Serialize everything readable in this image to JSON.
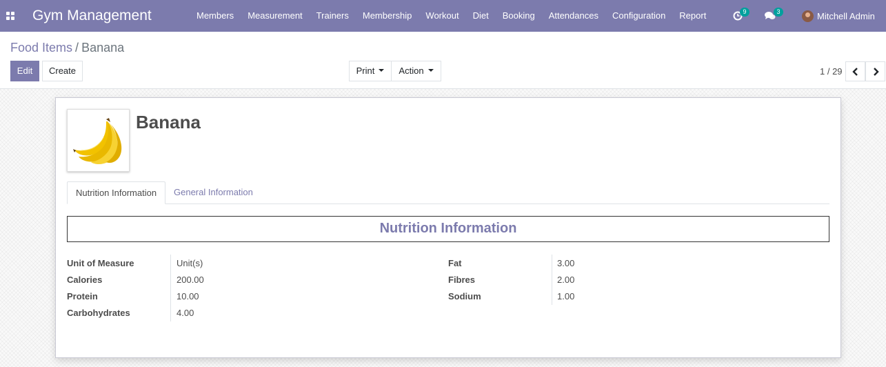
{
  "navbar": {
    "brand": "Gym Management",
    "menu": [
      "Members",
      "Measurement",
      "Trainers",
      "Membership",
      "Workout",
      "Diet",
      "Booking",
      "Attendances",
      "Configuration",
      "Report"
    ],
    "activity_count": "9",
    "message_count": "3",
    "user_name": "Mitchell Admin",
    "color": "#7c7bad"
  },
  "breadcrumb": {
    "parent": "Food Items",
    "separator": "/",
    "current": "Banana"
  },
  "toolbar": {
    "edit_label": "Edit",
    "create_label": "Create",
    "print_label": "Print",
    "action_label": "Action"
  },
  "pager": {
    "value": "1 / 29"
  },
  "record": {
    "title": "Banana",
    "image": "banana-image",
    "tabs": [
      "Nutrition Information",
      "General Information"
    ],
    "section_title": "Nutrition Information",
    "left_fields": [
      {
        "label": "Unit of Measure",
        "value": "Unit(s)"
      },
      {
        "label": "Calories",
        "value": "200.00"
      },
      {
        "label": "Protein",
        "value": "10.00"
      },
      {
        "label": "Carbohydrates",
        "value": "4.00"
      }
    ],
    "right_fields": [
      {
        "label": "Fat",
        "value": "3.00"
      },
      {
        "label": "Fibres",
        "value": "2.00"
      },
      {
        "label": "Sodium",
        "value": "1.00"
      }
    ]
  }
}
